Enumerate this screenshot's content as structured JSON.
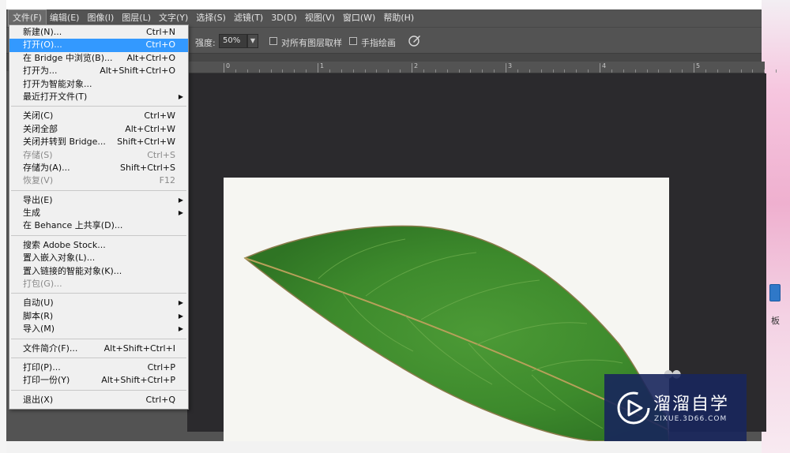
{
  "menubar": {
    "items": [
      {
        "label": "文件(F)",
        "active": true
      },
      {
        "label": "编辑(E)"
      },
      {
        "label": "图像(I)"
      },
      {
        "label": "图层(L)"
      },
      {
        "label": "文字(Y)"
      },
      {
        "label": "选择(S)"
      },
      {
        "label": "滤镜(T)"
      },
      {
        "label": "3D(D)"
      },
      {
        "label": "视图(V)"
      },
      {
        "label": "窗口(W)"
      },
      {
        "label": "帮助(H)"
      }
    ]
  },
  "options": {
    "strength_label": "强度:",
    "strength_value": "50%",
    "sample_all_layers_label": "对所有图层取样",
    "finger_painting_label": "手指绘画"
  },
  "ruler": {
    "labels": [
      "0",
      "1",
      "2",
      "3",
      "4",
      "5"
    ]
  },
  "file_menu": {
    "groups": [
      [
        {
          "label": "新建(N)...",
          "shortcut": "Ctrl+N"
        },
        {
          "label": "打开(O)...",
          "shortcut": "Ctrl+O",
          "highlighted": true
        },
        {
          "label": "在 Bridge 中浏览(B)...",
          "shortcut": "Alt+Ctrl+O"
        },
        {
          "label": "打开为...",
          "shortcut": "Alt+Shift+Ctrl+O"
        },
        {
          "label": "打开为智能对象..."
        },
        {
          "label": "最近打开文件(T)",
          "submenu": true
        }
      ],
      [
        {
          "label": "关闭(C)",
          "shortcut": "Ctrl+W"
        },
        {
          "label": "关闭全部",
          "shortcut": "Alt+Ctrl+W"
        },
        {
          "label": "关闭并转到 Bridge...",
          "shortcut": "Shift+Ctrl+W"
        },
        {
          "label": "存储(S)",
          "shortcut": "Ctrl+S",
          "disabled": true
        },
        {
          "label": "存储为(A)...",
          "shortcut": "Shift+Ctrl+S"
        },
        {
          "label": "恢复(V)",
          "shortcut": "F12",
          "disabled": true
        }
      ],
      [
        {
          "label": "导出(E)",
          "submenu": true
        },
        {
          "label": "生成",
          "submenu": true
        },
        {
          "label": "在 Behance 上共享(D)..."
        }
      ],
      [
        {
          "label": "搜索 Adobe Stock..."
        },
        {
          "label": "置入嵌入对象(L)..."
        },
        {
          "label": "置入链接的智能对象(K)..."
        },
        {
          "label": "打包(G)...",
          "disabled": true
        }
      ],
      [
        {
          "label": "自动(U)",
          "submenu": true
        },
        {
          "label": "脚本(R)",
          "submenu": true
        },
        {
          "label": "导入(M)",
          "submenu": true
        }
      ],
      [
        {
          "label": "文件简介(F)...",
          "shortcut": "Alt+Shift+Ctrl+I"
        }
      ],
      [
        {
          "label": "打印(P)...",
          "shortcut": "Ctrl+P"
        },
        {
          "label": "打印一份(Y)",
          "shortcut": "Alt+Shift+Ctrl+P"
        }
      ],
      [
        {
          "label": "退出(X)",
          "shortcut": "Ctrl+Q"
        }
      ]
    ]
  },
  "watermark": {
    "title": "溜溜自学",
    "subtitle": "ZIXUE.3D66.COM"
  },
  "side": {
    "text": "板"
  },
  "colors": {
    "menu_highlight": "#3399ff",
    "app_background": "#535353",
    "canvas_background": "#2b2a2d",
    "leaf_green": "#3d8a2c"
  },
  "icons": {
    "pressure_icon": "stylus-pressure-icon",
    "submenu_icon": "triangle-right-icon"
  }
}
